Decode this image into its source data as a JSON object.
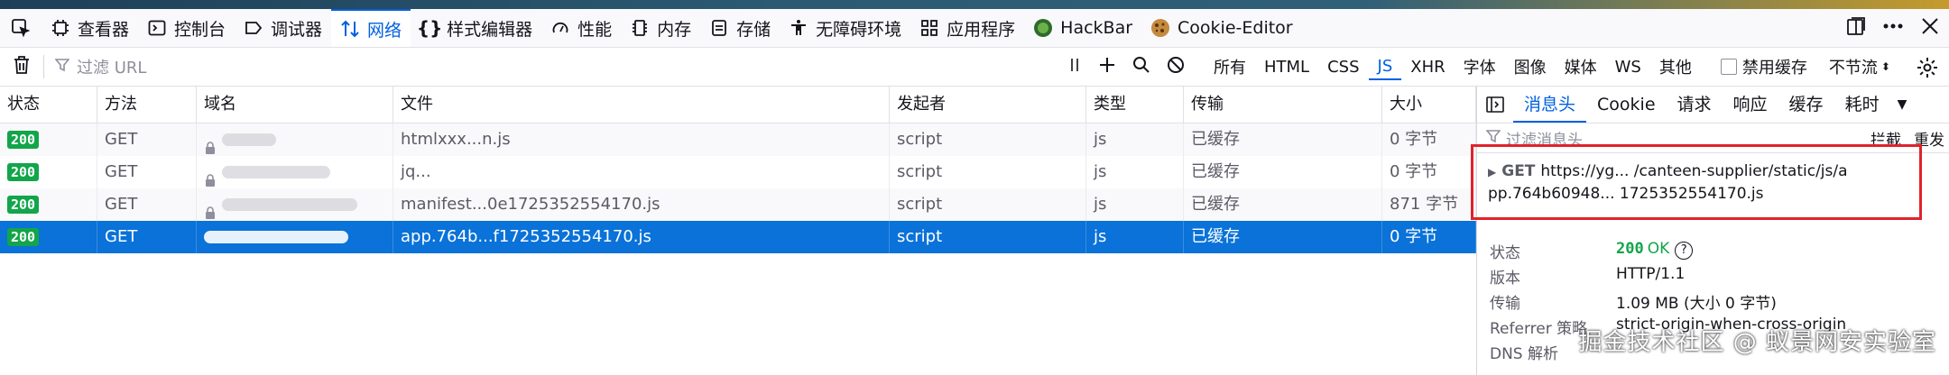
{
  "toolbar": {
    "items": [
      {
        "label": "",
        "icon": "pick-element-icon"
      },
      {
        "label": "查看器",
        "icon": "inspector-icon"
      },
      {
        "label": "控制台",
        "icon": "console-icon"
      },
      {
        "label": "调试器",
        "icon": "debugger-icon"
      },
      {
        "label": "网络",
        "icon": "network-icon",
        "active": true
      },
      {
        "label": "样式编辑器",
        "icon": "style-editor-icon"
      },
      {
        "label": "性能",
        "icon": "performance-icon"
      },
      {
        "label": "内存",
        "icon": "memory-icon"
      },
      {
        "label": "存储",
        "icon": "storage-icon"
      },
      {
        "label": "无障碍环境",
        "icon": "accessibility-icon"
      },
      {
        "label": "应用程序",
        "icon": "application-icon"
      },
      {
        "label": "HackBar",
        "icon": "hackbar-icon"
      },
      {
        "label": "Cookie-Editor",
        "icon": "cookie-icon"
      }
    ],
    "right_icons": [
      "dock-icon",
      "more-icon",
      "close-icon"
    ]
  },
  "filterbar": {
    "placeholder": "过滤 URL",
    "types": [
      "所有",
      "HTML",
      "CSS",
      "JS",
      "XHR",
      "字体",
      "图像",
      "媒体",
      "WS",
      "其他"
    ],
    "active_type": "JS",
    "disable_cache_label": "禁用缓存",
    "throttle_label": "不节流"
  },
  "table": {
    "headers": [
      "状态",
      "方法",
      "域名",
      "文件",
      "发起者",
      "类型",
      "传输",
      "大小"
    ],
    "rows": [
      {
        "status": "200",
        "method": "GET",
        "file": "htmlxxx...n.js",
        "initiator": "script",
        "type": "js",
        "transfer": "已缓存",
        "size": "0 字节"
      },
      {
        "status": "200",
        "method": "GET",
        "file": "jq...",
        "initiator": "script",
        "type": "js",
        "transfer": "已缓存",
        "size": "0 字节"
      },
      {
        "status": "200",
        "method": "GET",
        "file": "manifest...0e1725352554170.js",
        "initiator": "script",
        "type": "js",
        "transfer": "已缓存",
        "size": "871 字节"
      },
      {
        "status": "200",
        "method": "GET",
        "file": "app.764b...f1725352554170.js",
        "initiator": "script",
        "type": "js",
        "transfer": "已缓存",
        "size": "0 字节",
        "selected": true
      }
    ]
  },
  "side": {
    "tabs": [
      "消息头",
      "Cookie",
      "请求",
      "响应",
      "缓存",
      "耗时"
    ],
    "active_tab": "消息头",
    "filter_placeholder": "过滤消息头",
    "filter_buttons": [
      "拦截",
      "重发"
    ],
    "request_method": "GET",
    "request_url_line1": "https://yg...          /canteen-supplier/static/js/a",
    "request_url_line2": "pp.764b60948...          1725352554170.js",
    "fields": [
      {
        "key": "状态",
        "value": "OK",
        "code": "200"
      },
      {
        "key": "版本",
        "value": "HTTP/1.1"
      },
      {
        "key": "传输",
        "value": "1.09 MB (大小 0 字节)"
      },
      {
        "key": "Referrer 策略",
        "value": "strict-origin-when-cross-origin"
      },
      {
        "key": "DNS 解析",
        "value": ""
      }
    ]
  },
  "watermark": "掘金技术社区 @ 蚁景网安实验室",
  "colors": {
    "accent": "#0061e0",
    "selected_row": "#0a72d8",
    "status_ok": "#12a54a",
    "highlight_box": "#e0222b"
  }
}
